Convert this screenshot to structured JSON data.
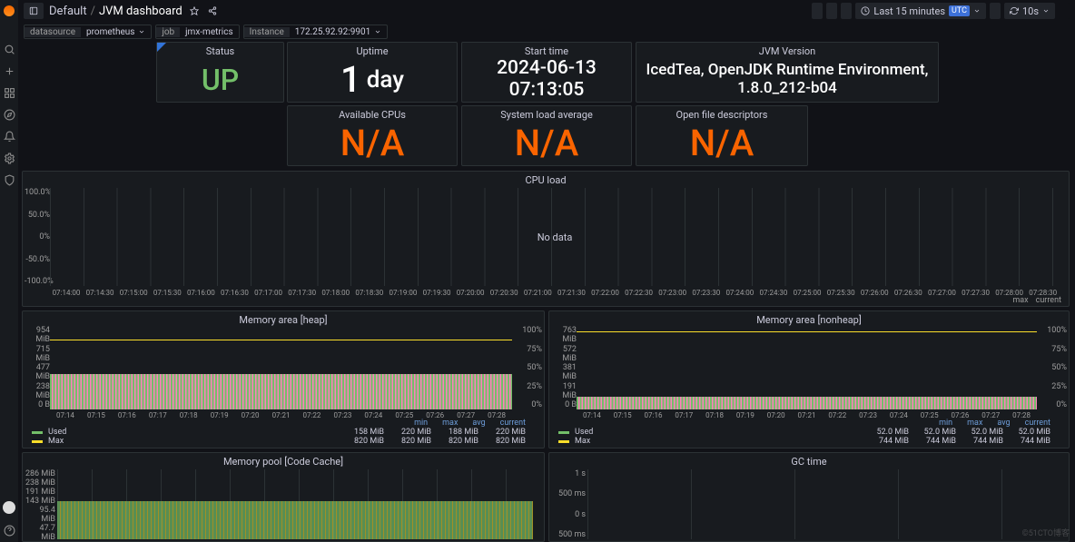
{
  "breadcrumb": {
    "default": "Default",
    "current": "JVM dashboard"
  },
  "topbar": {
    "timerange": "Last 15 minutes",
    "tz": "UTC",
    "refresh": "10s"
  },
  "vars": {
    "datasource_label": "datasource",
    "datasource_value": "prometheus",
    "job_label": "job",
    "job_value": "jmx-metrics",
    "instance_label": "Instance",
    "instance_value": "172.25.92.92:9901"
  },
  "panels": {
    "status": {
      "title": "Status",
      "value": "UP"
    },
    "uptime": {
      "title": "Uptime",
      "num": "1",
      "unit": "day"
    },
    "start": {
      "title": "Start time",
      "value": "2024-06-13 07:13:05"
    },
    "jvm": {
      "title": "JVM Version",
      "value": "IcedTea, OpenJDK Runtime Environment, 1.8.0_212-b04"
    },
    "cpus": {
      "title": "Available CPUs",
      "value": "N/A"
    },
    "load": {
      "title": "System load average",
      "value": "N/A"
    },
    "fd": {
      "title": "Open file descriptors",
      "value": "N/A"
    },
    "cpu": {
      "title": "CPU load",
      "nodata": "No data",
      "legend_max": "max",
      "legend_current": "current"
    },
    "heap": {
      "title": "Memory area [heap]"
    },
    "nonheap": {
      "title": "Memory area [nonheap]"
    },
    "pool": {
      "title": "Memory pool [Code Cache]"
    },
    "gc": {
      "title": "GC time"
    }
  },
  "chart_data": {
    "cpu": {
      "type": "line",
      "title": "CPU load",
      "yaxis": [
        "100.0%",
        "50.0%",
        "0%",
        "-50.0%",
        "-100.0%"
      ],
      "xaxis": [
        "07:14:00",
        "07:14:30",
        "07:15:00",
        "07:15:30",
        "07:16:00",
        "07:16:30",
        "07:17:00",
        "07:17:30",
        "07:18:00",
        "07:18:30",
        "07:19:00",
        "07:19:30",
        "07:20:00",
        "07:20:30",
        "07:21:00",
        "07:21:30",
        "07:22:00",
        "07:22:30",
        "07:23:00",
        "07:23:30",
        "07:24:00",
        "07:24:30",
        "07:25:00",
        "07:25:30",
        "07:26:00",
        "07:26:30",
        "07:27:00",
        "07:27:30",
        "07:28:00",
        "07:28:30"
      ],
      "nodata": true,
      "legend": [
        "max",
        "current"
      ]
    },
    "heap": {
      "type": "bar",
      "title": "Memory area [heap]",
      "y_left": [
        "954 MiB",
        "715 MiB",
        "477 MiB",
        "238 MiB",
        "0 B"
      ],
      "y_right": [
        "100%",
        "75%",
        "50%",
        "25%",
        "0%"
      ],
      "x": [
        "07:14",
        "07:15",
        "07:16",
        "07:17",
        "07:18",
        "07:19",
        "07:20",
        "07:21",
        "07:22",
        "07:23",
        "07:24",
        "07:25",
        "07:26",
        "07:27",
        "07:28"
      ],
      "legend_headers": [
        "min",
        "max",
        "avg",
        "current"
      ],
      "series": [
        {
          "name": "Used",
          "color": "#73bf69",
          "values": {
            "min": "158 MiB",
            "max": "220 MiB",
            "avg": "188 MiB",
            "current": "220 MiB"
          }
        },
        {
          "name": "Max",
          "color": "#fade2a",
          "values": {
            "min": "820 MiB",
            "max": "820 MiB",
            "avg": "820 MiB",
            "current": "820 MiB"
          }
        }
      ]
    },
    "nonheap": {
      "type": "bar",
      "title": "Memory area [nonheap]",
      "y_left": [
        "763 MiB",
        "572 MiB",
        "381 MiB",
        "191 MiB",
        "0 B"
      ],
      "y_right": [
        "100%",
        "75%",
        "50%",
        "25%",
        "0%"
      ],
      "x": [
        "07:14",
        "07:15",
        "07:16",
        "07:17",
        "07:18",
        "07:19",
        "07:20",
        "07:21",
        "07:22",
        "07:23",
        "07:24",
        "07:25",
        "07:26",
        "07:27",
        "07:28"
      ],
      "legend_headers": [
        "min",
        "max",
        "avg",
        "current"
      ],
      "series": [
        {
          "name": "Used",
          "color": "#73bf69",
          "values": {
            "min": "52.0 MiB",
            "max": "52.0 MiB",
            "avg": "52.0 MiB",
            "current": "52.0 MiB"
          }
        },
        {
          "name": "Max",
          "color": "#fade2a",
          "values": {
            "min": "744 MiB",
            "max": "744 MiB",
            "avg": "744 MiB",
            "current": "744 MiB"
          }
        }
      ]
    },
    "pool": {
      "type": "bar",
      "title": "Memory pool [Code Cache]",
      "y_left": [
        "286 MiB",
        "238 MiB",
        "191 MiB",
        "143 MiB",
        "95.4 MiB",
        "47.7 MiB"
      ]
    },
    "gc": {
      "type": "line",
      "title": "GC time",
      "y_left": [
        "1 s",
        "500 ms",
        "0 s",
        "500 ms"
      ]
    }
  },
  "watermark": "©51CTO博客"
}
